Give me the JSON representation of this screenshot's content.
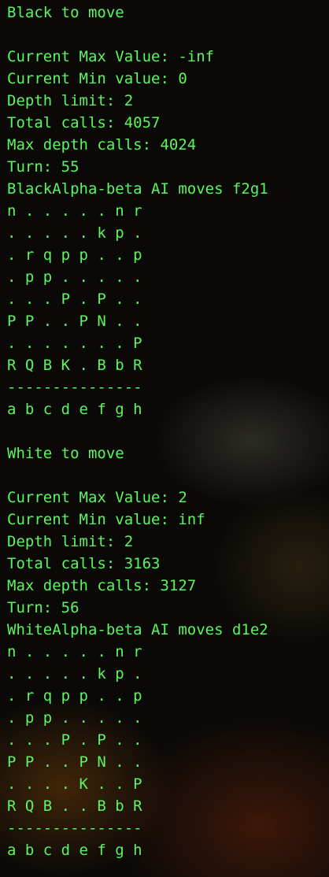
{
  "terminal": {
    "lines": [
      "Black to move",
      "",
      "Current Max Value: -inf",
      "Current Min value: 0",
      "Depth limit: 2",
      "Total calls: 4057",
      "Max depth calls: 4024",
      "Turn: 55",
      "BlackAlpha-beta AI moves f2g1",
      "n . . . . . n r",
      ". . . . . k p .",
      ". r q p p . . p",
      ". p p . . . . .",
      ". . . P . P . .",
      "P P . . P N . .",
      ". . . . . . . P",
      "R Q B K . B b R",
      "---------------",
      "a b c d e f g h",
      "",
      "White to move",
      "",
      "Current Max Value: 2",
      "Current Min value: inf",
      "Depth limit: 2",
      "Total calls: 3163",
      "Max depth calls: 3127",
      "Turn: 56",
      "WhiteAlpha-beta AI moves d1e2",
      "n . . . . . n r",
      ". . . . . k p .",
      ". r q p p . . p",
      ". p p . . . . .",
      ". . . P . P . .",
      "P P . . P N . .",
      ". . . . K . . P",
      "R Q B . . B b R",
      "---------------",
      "a b c d e f g h"
    ]
  },
  "colors": {
    "text": "#5df55d",
    "background": "#0b0907"
  }
}
